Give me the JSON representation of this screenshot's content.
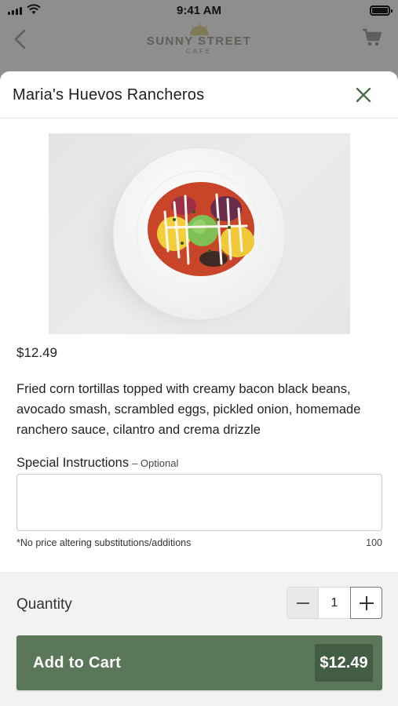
{
  "status_bar": {
    "time": "9:41 AM"
  },
  "nav": {
    "logo_line1": "SUNNY STREET",
    "logo_line2": "CAFE"
  },
  "modal": {
    "title": "Maria's Huevos Rancheros",
    "price": "$12.49",
    "description": "Fried corn tortillas topped with creamy bacon black beans, avocado smash, scrambled eggs, pickled onion, homemade ranchero sauce, cilantro and crema drizzle",
    "instructions": {
      "label": "Special Instructions",
      "optional": "– Optional",
      "value": "",
      "note": "*No price altering substitutions/additions",
      "char_limit": "100"
    }
  },
  "footer": {
    "quantity_label": "Quantity",
    "quantity": "1",
    "add_to_cart_label": "Add to Cart",
    "total": "$12.49"
  },
  "colors": {
    "brand_green": "#5a7859",
    "brand_green_dark": "#435d44",
    "close_icon": "#4d6b4f"
  },
  "icons": [
    "signal-icon",
    "wifi-icon",
    "battery-icon",
    "back-chevron-icon",
    "sun-logo-icon",
    "cart-icon",
    "close-icon",
    "minus-icon",
    "plus-icon"
  ]
}
